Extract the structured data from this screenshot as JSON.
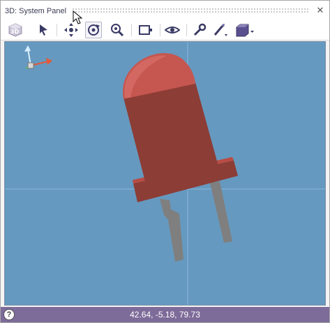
{
  "window": {
    "title": "3D: System Panel"
  },
  "toolbar": {
    "buttons": [
      {
        "name": "3d-view",
        "icon": "cube-3d-icon",
        "active": false
      },
      {
        "name": "select",
        "icon": "arrow-pointer-icon",
        "active": false
      },
      {
        "name": "pan",
        "icon": "move-arrows-icon",
        "active": false
      },
      {
        "name": "rotate",
        "icon": "rotate-icon",
        "active": true
      },
      {
        "name": "zoom",
        "icon": "magnifier-icon",
        "active": false
      },
      {
        "name": "zoom-fit",
        "icon": "frame-fit-icon",
        "active": false
      },
      {
        "name": "view",
        "icon": "eye-icon",
        "active": false
      },
      {
        "name": "tools",
        "icon": "wrench-icon",
        "active": false
      },
      {
        "name": "paint",
        "icon": "brush-icon",
        "active": false
      },
      {
        "name": "render-mode",
        "icon": "solid-box-icon",
        "active": false
      }
    ]
  },
  "status": {
    "coordinates": "42.64, -5.18, 79.73"
  },
  "colors": {
    "viewport_bg": "#6699bf",
    "led_body": "#8c3d36",
    "led_dome": "#d05a52",
    "legs": "#7a7a7a",
    "status_bar": "#7d6b99",
    "axis_x": "#e3593a",
    "axis_y": "#d8f0ff",
    "axis_z": "#55c06a"
  }
}
